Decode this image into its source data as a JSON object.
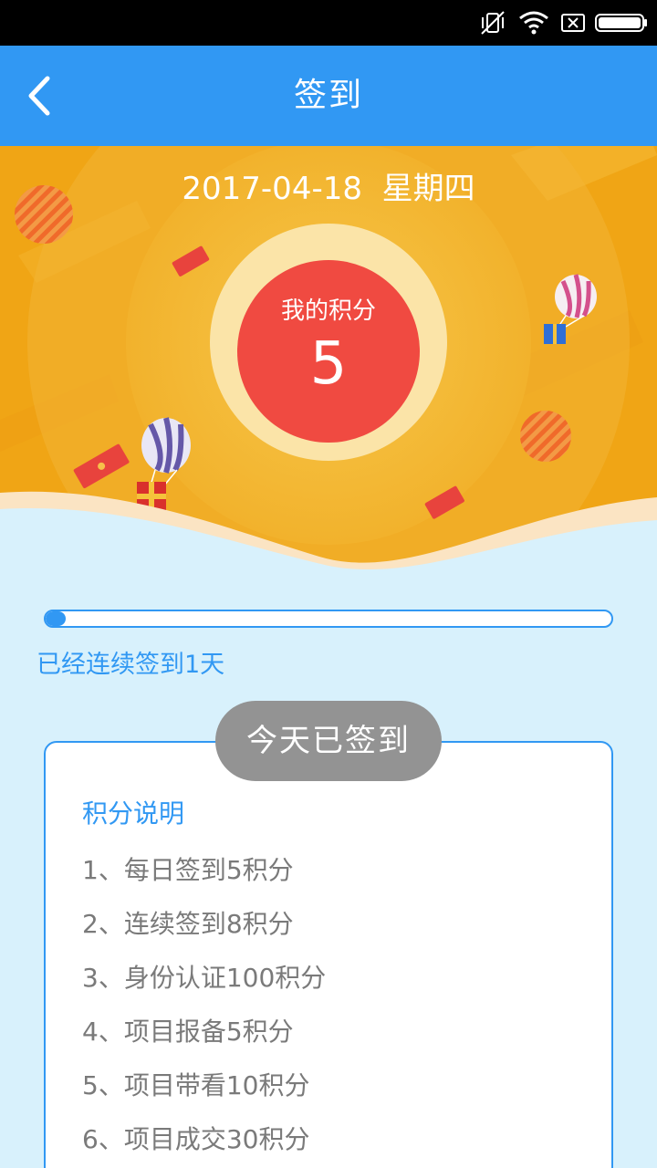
{
  "status_bar": {
    "icons": [
      "vibrate-off-icon",
      "wifi-icon",
      "sim-x-icon",
      "battery-icon"
    ]
  },
  "app_bar": {
    "back_icon": "chevron-left-icon",
    "title": "签到"
  },
  "hero": {
    "date": "2017-04-18",
    "weekday": "星期四",
    "points_label": "我的积分",
    "points_value": "5",
    "decorations": [
      "hot-air-balloon-icon",
      "gift-box-icon",
      "red-envelope-icon",
      "striped-ball-icon"
    ]
  },
  "progress": {
    "fraction": 0.035
  },
  "streak_text": "已经连续签到1天",
  "sign_button_label": "今天已签到",
  "rules": {
    "title": "积分说明",
    "items": [
      "1、每日签到5积分",
      "2、连续签到8积分",
      "3、身份认证100积分",
      "4、项目报备5积分",
      "5、项目带看10积分",
      "6、项目成交30积分"
    ]
  },
  "colors": {
    "primary": "#3198f3",
    "hero_orange": "#f0a515",
    "points_red": "#f04a41",
    "button_gray": "#939393",
    "page_bg": "#d8f1fc"
  }
}
